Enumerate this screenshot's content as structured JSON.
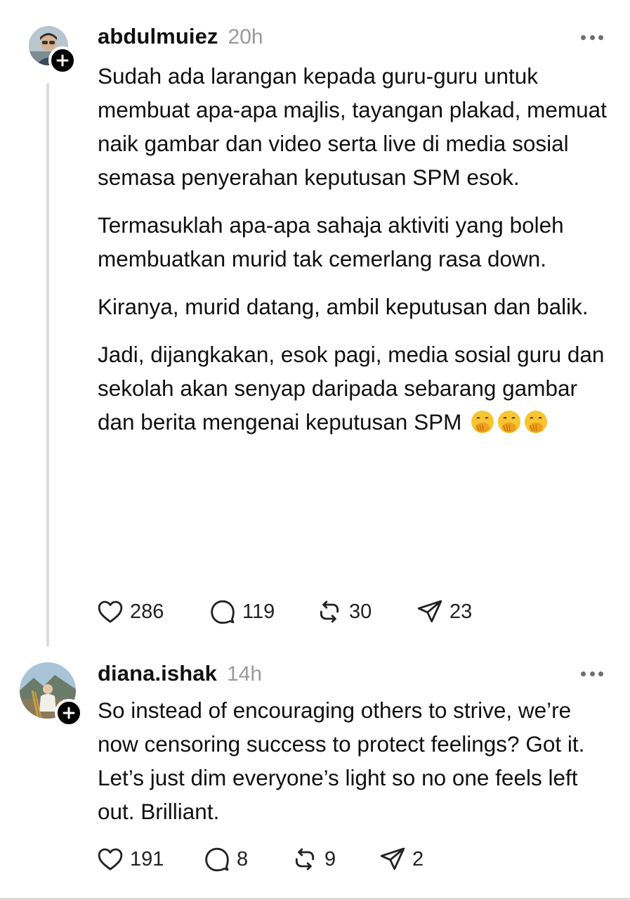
{
  "posts": [
    {
      "username": "abdulmuiez",
      "time": "20h",
      "paragraphs": [
        "Sudah ada larangan kepada guru-guru untuk membuat apa-apa majlis, tayangan plakad, memuat naik gambar dan video serta live di media sosial semasa penyerahan keputusan SPM esok.",
        "Termasuklah apa-apa sahaja aktiviti yang boleh membuatkan murid tak cemerlang rasa down.",
        "Kiranya, murid datang, ambil keputusan dan balik.",
        "Jadi, dijangkakan, esok pagi, media sosial guru dan sekolah akan senyap daripada sebarang gambar dan berita mengenai keputusan SPM"
      ],
      "emojis": [
        "face-with-hand-over-mouth-icon",
        "face-with-hand-over-mouth-icon",
        "face-with-hand-over-mouth-icon"
      ],
      "likes": "286",
      "replies": "119",
      "reposts": "30",
      "shares": "23"
    },
    {
      "username": "diana.ishak",
      "time": "14h",
      "paragraphs": [
        "So instead of encouraging others to strive, we’re now censoring success to protect feelings? Got it. Let’s just dim everyone’s light so no one feels left out. Brilliant."
      ],
      "likes": "191",
      "replies": "8",
      "reposts": "9",
      "shares": "2"
    }
  ],
  "icons": {
    "like": "heart-icon",
    "reply": "comment-bubble-icon",
    "repost": "repost-icon",
    "share": "send-icon",
    "more": "more-dots-icon",
    "follow": "plus-icon"
  },
  "colors": {
    "text": "#101010",
    "muted": "#9a9a9a",
    "thread_line": "#dcdcdc",
    "badge": "#000000"
  }
}
